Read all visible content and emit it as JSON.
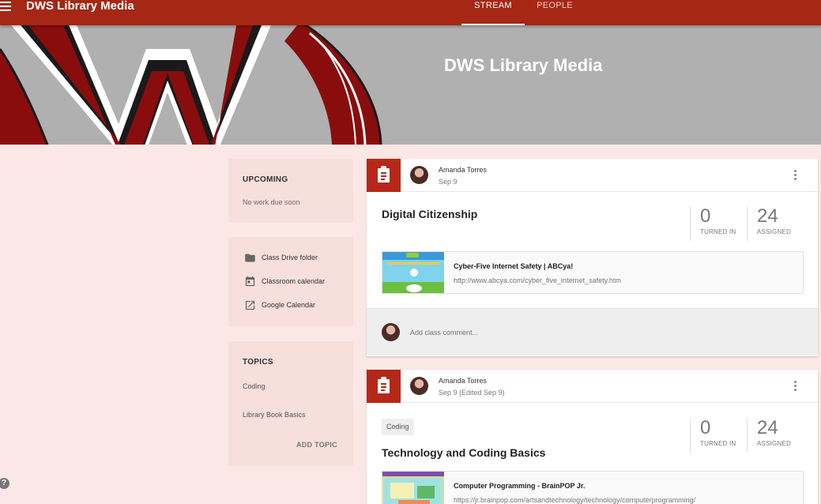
{
  "header": {
    "title": "DWS Library Media",
    "tabs": [
      {
        "label": "STREAM"
      },
      {
        "label": "PEOPLE"
      }
    ],
    "accent_color": "#a52714"
  },
  "banner": {
    "title": "DWS Library Media",
    "bg_color": "#b0b0b0"
  },
  "sidebar": {
    "upcoming": {
      "heading": "UPCOMING",
      "text": "No work due soon"
    },
    "links": [
      {
        "icon": "folder-icon",
        "label": "Class Drive folder"
      },
      {
        "icon": "calendar-icon",
        "label": "Classroom calendar"
      },
      {
        "icon": "open-external-icon",
        "label": "Google Calendar"
      }
    ],
    "topics": {
      "heading": "TOPICS",
      "items": [
        "Coding",
        "Library Book Basics"
      ],
      "add_label": "ADD TOPIC"
    }
  },
  "posts": [
    {
      "author": "Amanda Torres",
      "date": "Sep 9",
      "title": "Digital Citizenship",
      "turned_in": {
        "value": "0",
        "label": "TURNED IN"
      },
      "assigned": {
        "value": "24",
        "label": "ASSIGNED"
      },
      "attachment": {
        "title": "Cyber-Five Internet Safety | ABCya!",
        "url": "http://www.abcya.com/cyber_five_internet_safety.htm"
      },
      "comment_placeholder": "Add class comment..."
    },
    {
      "author": "Amanda Torres",
      "date": "Sep 9 (Edited Sep 9)",
      "topic": "Coding",
      "title": "Technology and Coding Basics",
      "turned_in": {
        "value": "0",
        "label": "TURNED IN"
      },
      "assigned": {
        "value": "24",
        "label": "ASSIGNED"
      },
      "attachment": {
        "title": "Computer Programming - BrainPOP Jr.",
        "url": "https://jr.brainpop.com/artsandtechnology/technology/computerprogramming/"
      }
    }
  ],
  "help": {
    "label": "?"
  }
}
